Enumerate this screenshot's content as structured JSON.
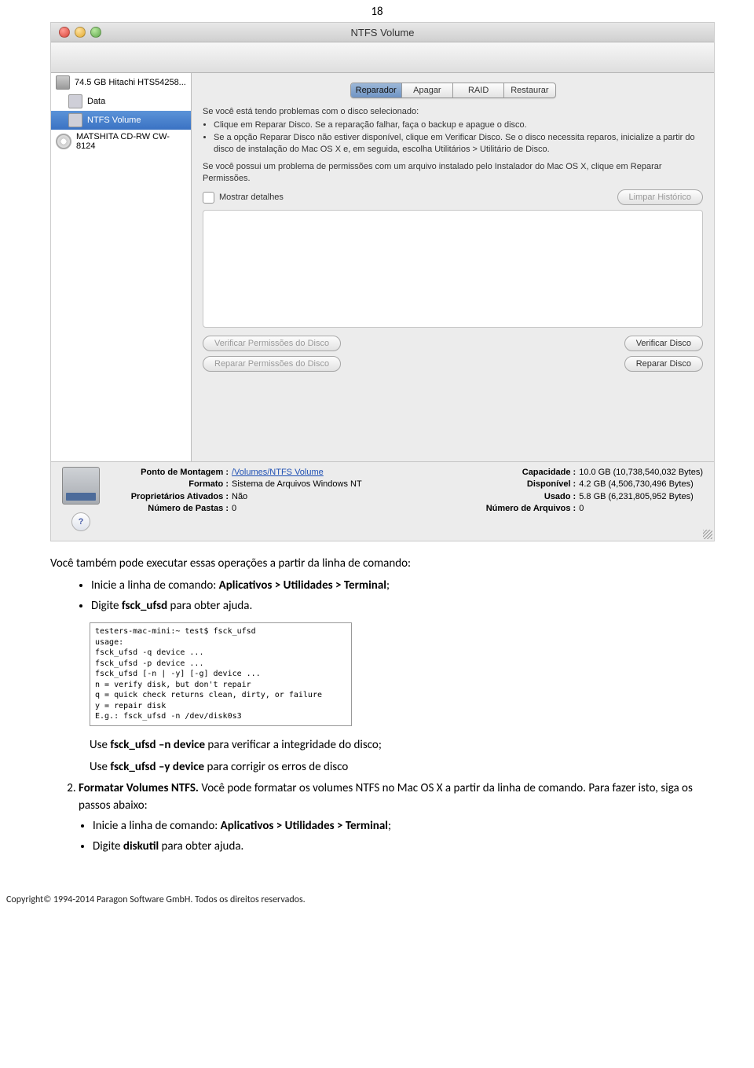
{
  "page_number": "18",
  "window": {
    "title": "NTFS Volume",
    "sidebar": [
      {
        "label": "74.5 GB Hitachi HTS54258...",
        "type": "hdd",
        "indent": false,
        "sel": false
      },
      {
        "label": "Data",
        "type": "vol",
        "indent": true,
        "sel": false
      },
      {
        "label": "NTFS Volume",
        "type": "vol",
        "indent": true,
        "sel": true
      },
      {
        "label": "MATSHITA CD-RW CW-8124",
        "type": "cd",
        "indent": false,
        "sel": false
      }
    ],
    "tabs": {
      "reparador": "Reparador",
      "apagar": "Apagar",
      "raid": "RAID",
      "restaurar": "Restaurar"
    },
    "intro1": "Se você está tendo problemas com o disco selecionado:",
    "bullets": [
      "Clique em Reparar Disco. Se a reparação falhar, faça o backup e apague o disco.",
      "Se a opção Reparar Disco não estiver disponível, clique em Verificar Disco. Se o disco necessita reparos, inicialize a partir do disco de instalação do Mac OS X e, em seguida, escolha Utilitários > Utilitário de Disco."
    ],
    "intro2": "Se você possui um problema de permissões com um arquivo instalado pelo Instalador do Mac OS X, clique em Reparar Permissões.",
    "show_details": "Mostrar detalhes",
    "btn_clear": "Limpar Histórico",
    "btn_vperm": "Verificar Permissões do Disco",
    "btn_rperm": "Reparar Permissões do Disco",
    "btn_vdisk": "Verificar Disco",
    "btn_rdisk": "Reparar Disco",
    "footer": {
      "ponto_k": "Ponto de Montagem :",
      "ponto_v": "/Volumes/NTFS Volume",
      "formato_k": "Formato :",
      "formato_v": "Sistema de Arquivos Windows NT",
      "propr_k": "Proprietários Ativados :",
      "propr_v": "Não",
      "pastas_k": "Número de Pastas :",
      "pastas_v": "0",
      "cap_k": "Capacidade :",
      "cap_v": "10.0 GB (10,738,540,032 Bytes)",
      "disp_k": "Disponível :",
      "disp_v": "4.2 GB (4,506,730,496 Bytes)",
      "usado_k": "Usado :",
      "usado_v": "5.8 GB (6,231,805,952 Bytes)",
      "arq_k": "Número de Arquivos :",
      "arq_v": "0"
    }
  },
  "terminal": {
    "l1": "testers-mac-mini:~ test$ fsck_ufsd",
    "l2": "usage:",
    "l3": "fsck_ufsd -q device ...",
    "l4": "fsck_ufsd -p device ...",
    "l5": "fsck_ufsd [-n | -y] [-g] device ...",
    "l6": "  n = verify disk, but don't repair",
    "l7": "  q = quick check returns clean, dirty, or failure",
    "l8": "  y = repair disk",
    "l9": "",
    "l10": "E.g.: fsck_ufsd -n /dev/disk0s3"
  },
  "doc": {
    "p1a": "Você também pode executar essas operações a partir da linha de comando:",
    "b1": "Inicie a linha de comando: ",
    "b1b": "Aplicativos > Utilidades > Terminal",
    "b1c": ";",
    "b2": "Digite ",
    "b2b": "fsck_ufsd",
    "b2c": " para obter ajuda.",
    "u1": "Use ",
    "u1b": "fsck_ufsd –n device",
    "u1c": " para verificar a integridade do disco;",
    "u2": "Use ",
    "u2b": "fsck_ufsd –y device",
    "u2c": " para corrigir os erros de disco",
    "o2a": "Formatar Volumes NTFS.",
    "o2b": " Você pode formatar os volumes NTFS no Mac OS X a partir da linha de comando. Para fazer isto, siga os passos abaixo:",
    "b3": "Inicie a linha de comando: ",
    "b3b": "Aplicativos > Utilidades > Terminal",
    "b3c": ";",
    "b4": "Digite ",
    "b4b": "diskutil",
    "b4c": " para obter ajuda."
  },
  "copyright": "Copyright© 1994-2014 Paragon Software GmbH. Todos os direitos reservados."
}
